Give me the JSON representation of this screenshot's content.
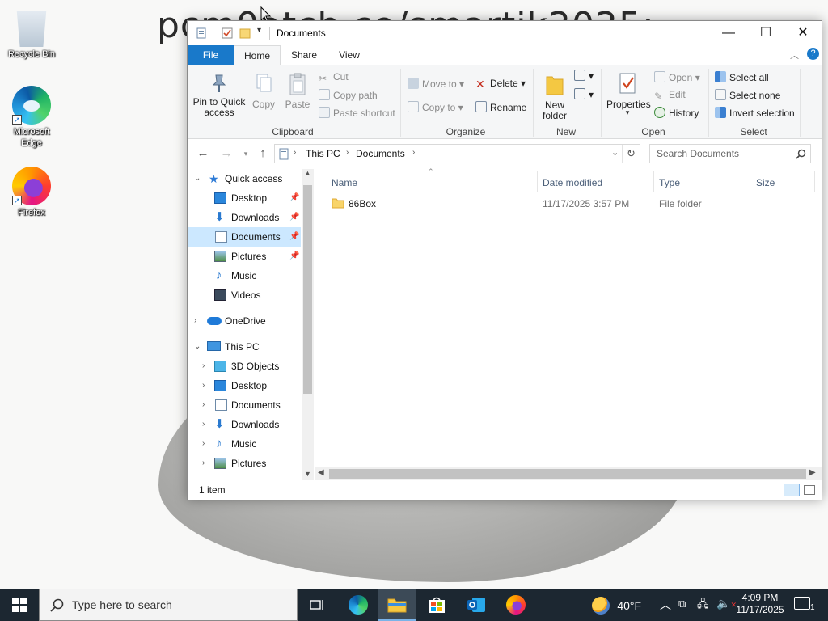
{
  "desktop": {
    "wallpaper_text": "pcm0atch.co/smartik2025:",
    "icons": [
      {
        "label": "Recycle Bin",
        "icon": "recycle-bin-icon"
      },
      {
        "label": "Microsoft Edge",
        "icon": "edge-icon"
      },
      {
        "label": "Firefox",
        "icon": "firefox-icon"
      }
    ]
  },
  "window": {
    "title": "Documents",
    "controls": {
      "minimize": "—",
      "maximize": "☐",
      "close": "✕"
    },
    "tabs": [
      {
        "label": "File"
      },
      {
        "label": "Home"
      },
      {
        "label": "Share"
      },
      {
        "label": "View"
      }
    ],
    "ribbon": {
      "clipboard": {
        "label": "Clipboard",
        "pin": "Pin to Quick access",
        "copy": "Copy",
        "paste": "Paste",
        "cut": "Cut",
        "copy_path": "Copy path",
        "paste_shortcut": "Paste shortcut"
      },
      "organize": {
        "label": "Organize",
        "move_to": "Move to",
        "copy_to": "Copy to",
        "delete": "Delete",
        "rename": "Rename"
      },
      "new": {
        "label": "New",
        "new_folder": "New folder"
      },
      "open": {
        "label": "Open",
        "properties": "Properties",
        "open": "Open",
        "edit": "Edit",
        "history": "History"
      },
      "select": {
        "label": "Select",
        "select_all": "Select all",
        "select_none": "Select none",
        "invert": "Invert selection"
      }
    },
    "address": {
      "crumbs": [
        "This PC",
        "Documents"
      ],
      "search_placeholder": "Search Documents"
    },
    "nav": {
      "quick_access": "Quick access",
      "quick_items": [
        "Desktop",
        "Downloads",
        "Documents",
        "Pictures",
        "Music",
        "Videos"
      ],
      "onedrive": "OneDrive",
      "this_pc": "This PC",
      "pc_items": [
        "3D Objects",
        "Desktop",
        "Documents",
        "Downloads",
        "Music",
        "Pictures"
      ]
    },
    "columns": {
      "name": "Name",
      "date": "Date modified",
      "type": "Type",
      "size": "Size"
    },
    "files": [
      {
        "name": "86Box",
        "date": "11/17/2025 3:57 PM",
        "type": "File folder",
        "size": ""
      }
    ],
    "status": "1 item"
  },
  "taskbar": {
    "search_placeholder": "Type here to search",
    "weather": "40°F",
    "time": "4:09 PM",
    "date": "11/17/2025",
    "notification_count": "1"
  }
}
